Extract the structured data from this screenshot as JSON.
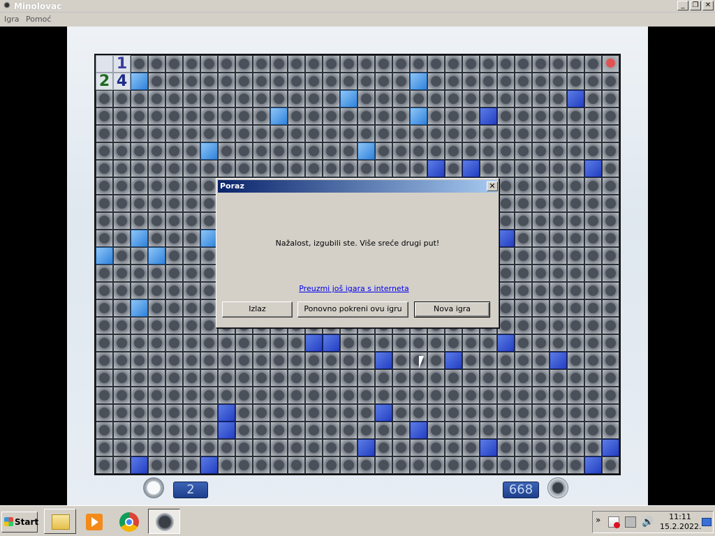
{
  "window": {
    "title": "Minolovac",
    "minimize": "_",
    "restore": "❐",
    "close": "✕"
  },
  "menu": {
    "game": "Igra",
    "help": "Pomoć"
  },
  "board": {
    "open_cells": [
      [
        0,
        0
      ],
      [
        0,
        1
      ],
      [
        1,
        0
      ],
      [
        1,
        1
      ]
    ],
    "numbers": [
      {
        "row": 0,
        "col": 1,
        "text": "1",
        "color": "#3c3ca0"
      },
      {
        "row": 1,
        "col": 0,
        "text": "2",
        "color": "#1b6b1b"
      },
      {
        "row": 1,
        "col": 1,
        "text": "4",
        "color": "#1e2c8a"
      }
    ],
    "flagged_cells": [
      [
        1,
        2
      ],
      [
        1,
        18
      ],
      [
        2,
        14
      ],
      [
        3,
        10
      ],
      [
        3,
        18
      ],
      [
        5,
        6
      ],
      [
        5,
        15
      ],
      [
        10,
        2
      ],
      [
        10,
        6
      ],
      [
        11,
        0
      ],
      [
        11,
        3
      ],
      [
        14,
        2
      ]
    ],
    "dark_cells": [
      [
        2,
        27
      ],
      [
        3,
        22
      ],
      [
        6,
        19
      ],
      [
        6,
        21
      ],
      [
        6,
        28
      ],
      [
        10,
        23
      ],
      [
        16,
        12
      ],
      [
        16,
        13
      ],
      [
        16,
        23
      ],
      [
        17,
        16
      ],
      [
        17,
        20
      ],
      [
        17,
        26
      ],
      [
        20,
        7
      ],
      [
        20,
        16
      ],
      [
        21,
        7
      ],
      [
        21,
        18
      ],
      [
        22,
        15
      ],
      [
        22,
        22
      ],
      [
        22,
        29
      ],
      [
        23,
        2
      ],
      [
        23,
        6
      ],
      [
        23,
        28
      ]
    ],
    "red_cells": [
      [
        0,
        29
      ]
    ]
  },
  "dialog": {
    "title": "Poraz",
    "close": "✕",
    "message": "Nažalost, izgubili ste. Više sreće drugi put!",
    "link": "Preuzmi još igara s interneta",
    "btn_exit": "Izlaz",
    "btn_restart": "Ponovno pokreni ovu igru",
    "btn_new": "Nova igra"
  },
  "counters": {
    "time": "2",
    "mines": "668"
  },
  "taskbar": {
    "start": "Start",
    "tray_arrow": "»",
    "volume": "🔊",
    "clock_time": "11:11",
    "clock_date": "15.2.2022."
  }
}
